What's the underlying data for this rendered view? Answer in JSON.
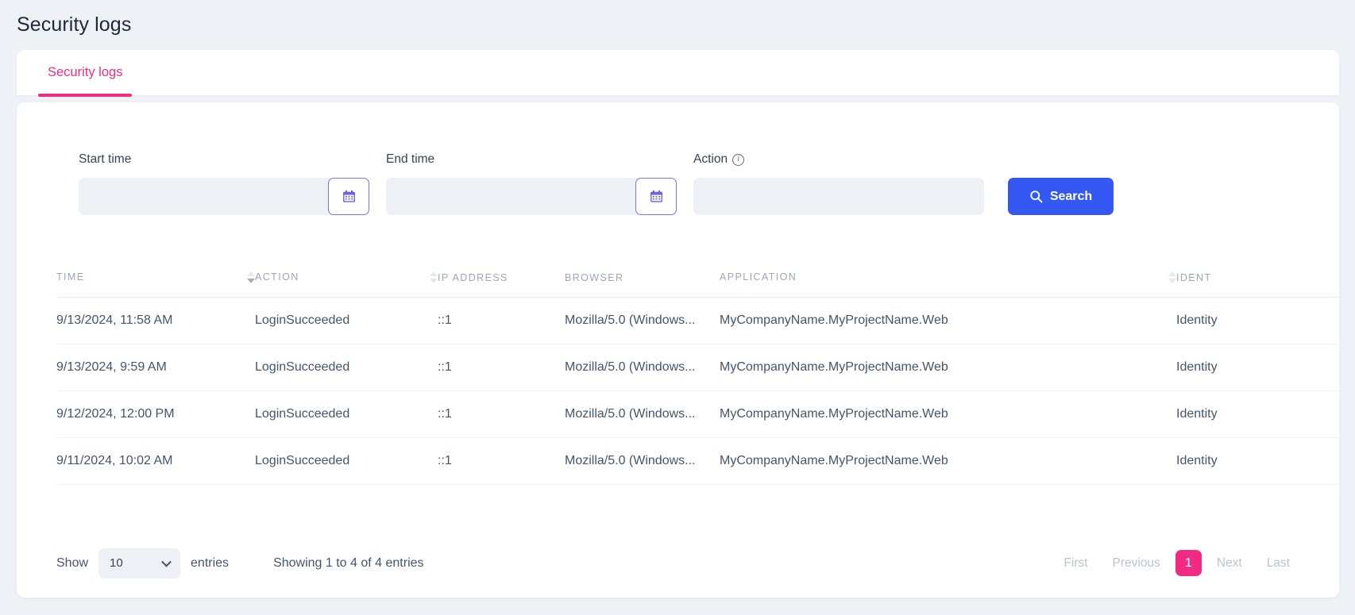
{
  "page": {
    "title": "Security logs"
  },
  "tabs": [
    {
      "label": "Security logs",
      "active": true
    }
  ],
  "filters": {
    "start_time": {
      "label": "Start time",
      "value": "",
      "placeholder": "",
      "calendar_icon": "calendar-icon"
    },
    "end_time": {
      "label": "End time",
      "value": "",
      "placeholder": "",
      "calendar_icon": "calendar-icon"
    },
    "action": {
      "label": "Action",
      "info_icon": "info-icon",
      "info_glyph": "i",
      "value": "",
      "placeholder": ""
    },
    "search_button": {
      "label": "Search",
      "icon": "search-icon"
    }
  },
  "table": {
    "columns": [
      {
        "label": "TIME",
        "sortable": true,
        "sorted": "desc"
      },
      {
        "label": "ACTION",
        "sortable": true,
        "sorted": "none"
      },
      {
        "label": "IP ADDRESS",
        "sortable": false,
        "sorted": "none"
      },
      {
        "label": "BROWSER",
        "sortable": false,
        "sorted": "none"
      },
      {
        "label": "APPLICATION",
        "sortable": true,
        "sorted": "none"
      },
      {
        "label": "IDENT",
        "sortable": false,
        "sorted": "none"
      }
    ],
    "rows": [
      {
        "time": "9/13/2024, 11:58 AM",
        "action": "LoginSucceeded",
        "ip": "::1",
        "browser": "Mozilla/5.0 (Windows...",
        "application": "MyCompanyName.MyProjectName.Web",
        "identity": "Identity"
      },
      {
        "time": "9/13/2024, 9:59 AM",
        "action": "LoginSucceeded",
        "ip": "::1",
        "browser": "Mozilla/5.0 (Windows...",
        "application": "MyCompanyName.MyProjectName.Web",
        "identity": "Identity"
      },
      {
        "time": "9/12/2024, 12:00 PM",
        "action": "LoginSucceeded",
        "ip": "::1",
        "browser": "Mozilla/5.0 (Windows...",
        "application": "MyCompanyName.MyProjectName.Web",
        "identity": "Identity"
      },
      {
        "time": "9/11/2024, 10:02 AM",
        "action": "LoginSucceeded",
        "ip": "::1",
        "browser": "Mozilla/5.0 (Windows...",
        "application": "MyCompanyName.MyProjectName.Web",
        "identity": "Identity"
      }
    ]
  },
  "footer": {
    "show_label": "Show",
    "page_size": "10",
    "entries_label": "entries",
    "showing_text": "Showing 1 to 4 of 4 entries",
    "pagination": {
      "first": "First",
      "previous": "Previous",
      "current_page": "1",
      "next": "Next",
      "last": "Last"
    }
  },
  "colors": {
    "page_background": "#eef1f5",
    "card_background": "#ffffff",
    "accent_pink": "#f22a81",
    "accent_blue": "#3558f4",
    "accent_purple": "#7b73e0",
    "field_background": "#edf1f5",
    "text_primary": "#44556b",
    "text_header": "#9aa7b8",
    "text_muted": "#b9c3cf"
  }
}
